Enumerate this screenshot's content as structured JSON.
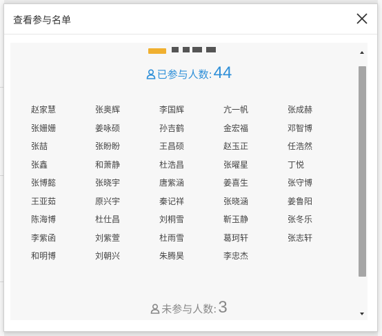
{
  "dialog": {
    "title": "查看参与名单"
  },
  "participated": {
    "label": "已参与人数:",
    "count": "44",
    "names": [
      "赵家慧",
      "张奥辉",
      "李国辉",
      "亢一帆",
      "张成赫",
      "张姗姗",
      "姜咏硕",
      "孙吉鹤",
      "金宏福",
      "邓智博",
      "张喆",
      "张盼盼",
      "王昌硕",
      "赵玉正",
      "任浩然",
      "张鑫",
      "和萧静",
      "杜浩昌",
      "张曜星",
      "丁悦",
      "张博懿",
      "张晓宇",
      "唐紫涵",
      "姜喜生",
      "张守博",
      "王亚茹",
      "原兴宇",
      "秦记祥",
      "张晓涵",
      "姜鲁阳",
      "陈海博",
      "杜仕昌",
      "刘桐雪",
      "靳玉静",
      "张冬乐",
      "李紫函",
      "刘紫萱",
      "杜雨雪",
      "葛珂轩",
      "张志轩",
      "和明博",
      "刘朝兴",
      "朱腾昊",
      "李忠杰"
    ]
  },
  "not_participated": {
    "label": "未参与人数:",
    "count": "3"
  },
  "icons": {
    "close": "close-icon",
    "person": "person-icon",
    "scroll_up": "scroll-up-arrow-icon",
    "scroll_down": "scroll-down-arrow-icon"
  },
  "colors": {
    "accent": "#2e8fd8",
    "muted": "#888888",
    "badge": "#f0b030"
  }
}
